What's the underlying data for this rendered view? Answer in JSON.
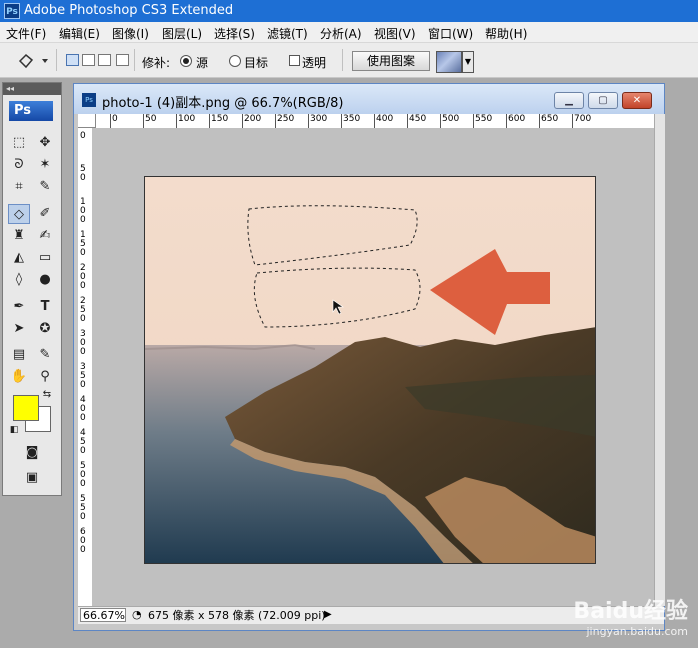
{
  "app": {
    "title": "Adobe Photoshop CS3 Extended",
    "icon_label": "Ps"
  },
  "menu": [
    "文件(F)",
    "编辑(E)",
    "图像(I)",
    "图层(L)",
    "选择(S)",
    "滤镜(T)",
    "分析(A)",
    "视图(V)",
    "窗口(W)",
    "帮助(H)"
  ],
  "options": {
    "patch_label": "修补:",
    "source_label": "源",
    "destination_label": "目标",
    "transparent_label": "透明",
    "use_pattern_label": "使用图案",
    "source_selected": true,
    "transparent_checked": false
  },
  "toolbox": {
    "logo": "Ps",
    "active_tool": "patch-tool",
    "foreground_color": "#ffff00",
    "background_color": "#ffffff"
  },
  "document": {
    "title": "photo-1 (4)副本.png @ 66.7%(RGB/8)",
    "ruler_h": [
      "0",
      "50",
      "100",
      "150",
      "200",
      "250",
      "300",
      "350",
      "400",
      "450",
      "500",
      "550",
      "600",
      "650",
      "700"
    ],
    "ruler_v": [
      "0",
      "5 0",
      "1 0 0",
      "1 5 0",
      "2 0 0",
      "2 5 0",
      "3 0 0",
      "3 5 0",
      "4 0 0",
      "4 5 0",
      "5 0 0",
      "5 5 0",
      "6 0 0"
    ],
    "zoom": "66.67%",
    "status": "675 像素 x 578 像素 (72.009 ppi)"
  },
  "annotation": {
    "arrow_color": "#dd5f3f"
  },
  "watermark": {
    "brand": "Baidu经验",
    "url": "jingyan.baidu.com"
  }
}
